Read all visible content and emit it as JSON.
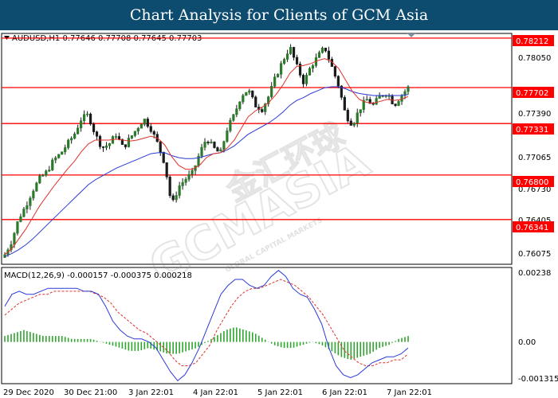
{
  "title": "Chart Analysis for Clients of GCM Asia",
  "chart_data": [
    {
      "type": "candlestick",
      "header": "AUDUSD,H1  0.77646 0.77708 0.77645 0.77703",
      "ylim": [
        0.7588,
        0.7826
      ],
      "y_ticks": [
        "0.78050",
        "0.77390",
        "0.77065",
        "0.76730",
        "0.76405",
        "0.76075"
      ],
      "levels": [
        {
          "value": 0.78212,
          "label": "0.78212"
        },
        {
          "value": 0.77702,
          "label": "0.77702"
        },
        {
          "value": 0.77331,
          "label": "0.77331"
        },
        {
          "value": 0.768,
          "label": "0.76800"
        },
        {
          "value": 0.76341,
          "label": "0.76341"
        }
      ],
      "close_path": [
        0.7598,
        0.7612,
        0.7635,
        0.7648,
        0.7664,
        0.7676,
        0.7683,
        0.7695,
        0.7702,
        0.7712,
        0.7722,
        0.7738,
        0.7742,
        0.7722,
        0.7708,
        0.7712,
        0.7722,
        0.7708,
        0.7718,
        0.7728,
        0.7738,
        0.7728,
        0.7712,
        0.7692,
        0.7648,
        0.7668,
        0.7676,
        0.7682,
        0.7702,
        0.7718,
        0.7708,
        0.7702,
        0.7728,
        0.7742,
        0.7762,
        0.7768,
        0.7752,
        0.7748,
        0.7762,
        0.7782,
        0.7798,
        0.7812,
        0.7792,
        0.7775,
        0.7792,
        0.7802,
        0.7812,
        0.7792,
        0.7772,
        0.7742,
        0.7732,
        0.7748,
        0.7758,
        0.7752,
        0.7762,
        0.7765,
        0.7752,
        0.7762,
        0.777
      ],
      "ma_fast": [
        0.7598,
        0.7604,
        0.7614,
        0.7624,
        0.7636,
        0.7648,
        0.7658,
        0.7668,
        0.7677,
        0.7686,
        0.7694,
        0.7704,
        0.7712,
        0.7716,
        0.7716,
        0.7716,
        0.7717,
        0.7716,
        0.7715,
        0.7716,
        0.7718,
        0.772,
        0.7718,
        0.7711,
        0.7699,
        0.769,
        0.7686,
        0.7686,
        0.769,
        0.7698,
        0.7702,
        0.7703,
        0.7708,
        0.7716,
        0.7728,
        0.774,
        0.7746,
        0.775,
        0.7755,
        0.7763,
        0.7773,
        0.7785,
        0.7792,
        0.7793,
        0.7795,
        0.7798,
        0.78,
        0.7797,
        0.779,
        0.7778,
        0.7766,
        0.7758,
        0.7755,
        0.7754,
        0.7756,
        0.7758,
        0.7757,
        0.7758,
        0.7761
      ],
      "ma_slow": [
        0.7596,
        0.7599,
        0.7603,
        0.7608,
        0.7614,
        0.7621,
        0.7628,
        0.7635,
        0.7642,
        0.7649,
        0.7656,
        0.7663,
        0.767,
        0.7675,
        0.7679,
        0.7683,
        0.7687,
        0.769,
        0.7693,
        0.7696,
        0.7699,
        0.7702,
        0.7703,
        0.7703,
        0.77,
        0.7698,
        0.7697,
        0.7697,
        0.7698,
        0.77,
        0.7702,
        0.7703,
        0.7706,
        0.771,
        0.7716,
        0.7722,
        0.7726,
        0.773,
        0.7734,
        0.7739,
        0.7745,
        0.7752,
        0.7757,
        0.776,
        0.7764,
        0.7767,
        0.777,
        0.7771,
        0.7771,
        0.7769,
        0.7766,
        0.7764,
        0.7763,
        0.7762,
        0.7762,
        0.7762,
        0.7762,
        0.7762,
        0.7763
      ]
    },
    {
      "type": "macd",
      "header": "MACD(12,26,9) -0.000157 -0.000375 0.000218",
      "ylim": [
        -0.0014,
        0.0025
      ],
      "y_ticks": [
        "0.00238",
        "0.00",
        "-0.001315"
      ],
      "macd": [
        0.0012,
        0.0016,
        0.0017,
        0.0016,
        0.0016,
        0.0017,
        0.0018,
        0.0018,
        0.0018,
        0.0018,
        0.0018,
        0.0017,
        0.0017,
        0.0016,
        0.0012,
        0.0007,
        0.0004,
        0.0002,
        0.0001,
        0.0001,
        0.0,
        -0.0002,
        -0.0006,
        -0.001,
        -0.0013,
        -0.0011,
        -0.0007,
        -0.0002,
        0.0004,
        0.001,
        0.0016,
        0.0019,
        0.0021,
        0.0021,
        0.0019,
        0.0018,
        0.0019,
        0.0022,
        0.0024,
        0.0022,
        0.0018,
        0.0016,
        0.0015,
        0.0011,
        0.0006,
        -0.0002,
        -0.0008,
        -0.0011,
        -0.0012,
        -0.0011,
        -0.0009,
        -0.0007,
        -0.0006,
        -0.0005,
        -0.0005,
        -0.0004,
        -0.0002
      ],
      "signal": [
        0.0009,
        0.0011,
        0.0013,
        0.0014,
        0.0015,
        0.0016,
        0.0016,
        0.0017,
        0.0017,
        0.0017,
        0.0017,
        0.0017,
        0.0017,
        0.0016,
        0.0015,
        0.0013,
        0.001,
        0.0008,
        0.0006,
        0.0004,
        0.0003,
        0.0001,
        -0.0001,
        -0.0003,
        -0.0006,
        -0.0008,
        -0.0008,
        -0.0007,
        -0.0004,
        -0.0001,
        0.0004,
        0.0008,
        0.0012,
        0.0015,
        0.0017,
        0.0018,
        0.0018,
        0.0019,
        0.002,
        0.0021,
        0.002,
        0.0019,
        0.0017,
        0.0015,
        0.0012,
        0.0009,
        0.0005,
        0.0001,
        -0.0003,
        -0.0005,
        -0.0007,
        -0.0008,
        -0.0008,
        -0.0007,
        -0.0007,
        -0.0006,
        -0.0006,
        -0.0004
      ],
      "histogram": [
        0.0002,
        0.0003,
        0.0004,
        0.0003,
        0.0002,
        0.0002,
        0.0002,
        0.0001,
        0.0001,
        0.0001,
        0.0,
        -0.0001,
        -0.0002,
        -0.0003,
        -0.0003,
        -0.0002,
        -0.0003,
        -0.0004,
        -0.0004,
        -0.0003,
        -0.0002,
        0.0,
        0.0002,
        0.0004,
        0.0005,
        0.0004,
        0.0003,
        0.0001,
        -0.0001,
        -0.0002,
        -0.0002,
        -0.0001,
        0.0,
        -0.0001,
        -0.0003,
        -0.0005,
        -0.0006,
        -0.0005,
        -0.0004,
        -0.0002,
        -0.0001,
        0.0001,
        0.0002
      ]
    }
  ],
  "x_ticks": [
    "29 Dec 2020",
    "30 Dec 21:00",
    "3 Jan 22:01",
    "4 Jan 22:01",
    "5 Jan 22:01",
    "6 Jan 22:01",
    "7 Jan 22:01"
  ],
  "watermark": {
    "text": "GCMASIA",
    "subtext": "GLOBAL CAPITAL MARKETS",
    "cn": "金汇环球"
  },
  "colors": {
    "bull": "#2b7a2b",
    "bear": "#1a1a1a",
    "ma_fast": "#e0302a",
    "ma_slow": "#2a3ad6",
    "levels": "#ff0000",
    "macd": "#2a3ad6",
    "signal": "#e0302a",
    "hist": "#2fa52f"
  }
}
